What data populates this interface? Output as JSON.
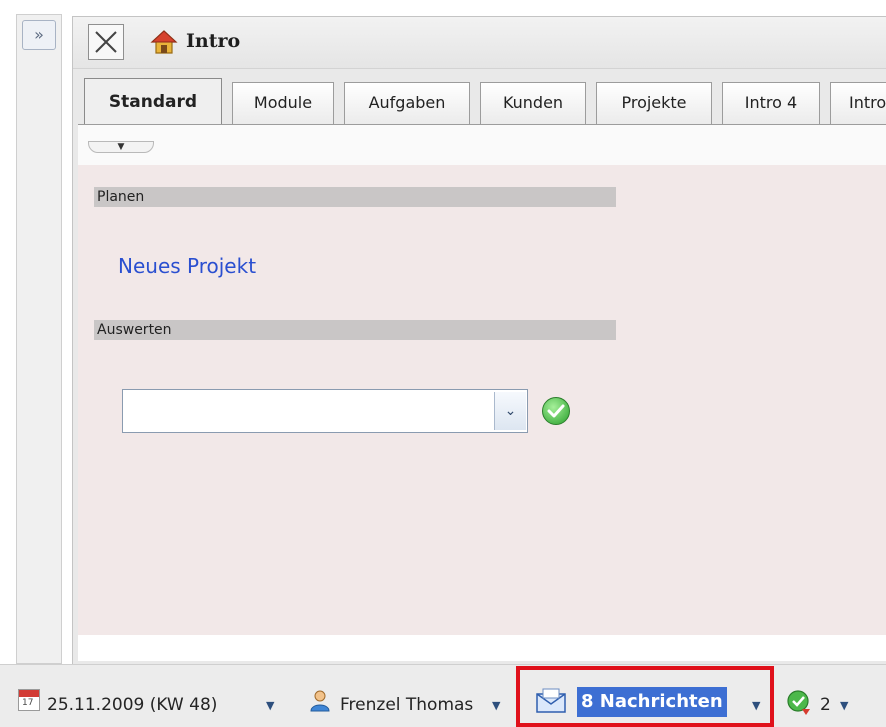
{
  "sidebar": {
    "expand_glyph": "»"
  },
  "window": {
    "title": "Intro"
  },
  "tabs": [
    {
      "label": "Standard"
    },
    {
      "label": "Module"
    },
    {
      "label": "Aufgaben"
    },
    {
      "label": "Kunden"
    },
    {
      "label": "Projekte"
    },
    {
      "label": "Intro 4"
    },
    {
      "label": "Intro"
    }
  ],
  "content": {
    "collapse_glyph": "▼",
    "sections": [
      {
        "header": "Planen"
      },
      {
        "header": "Auswerten"
      }
    ],
    "new_project_link": "Neues Projekt",
    "dropdown": {
      "value": "",
      "arrow_glyph": "⌄"
    }
  },
  "statusbar": {
    "date": "25.11.2009 (KW 48)",
    "calendar_day": "17",
    "user": "Frenzel Thomas",
    "messages": "8 Nachrichten",
    "sync_count": "2",
    "dropdown_glyph": "▼"
  },
  "colors": {
    "highlight_border": "#e0111b",
    "link": "#2a4fd0",
    "selection": "#3d6fd3",
    "content_bg": "#f2e8e8"
  },
  "icons": [
    "expand-icon",
    "close-icon",
    "home-icon",
    "calendar-icon",
    "user-icon",
    "mail-icon",
    "refresh-icon",
    "checkmark-icon"
  ]
}
